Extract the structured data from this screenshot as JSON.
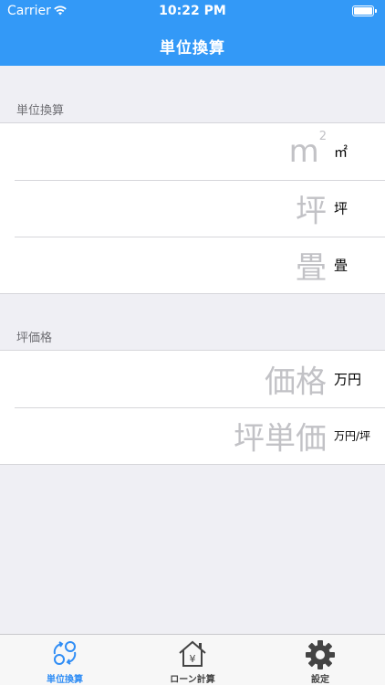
{
  "status_bar": {
    "carrier": "Carrier",
    "time": "10:22 PM"
  },
  "nav": {
    "title": "単位換算"
  },
  "area_section": {
    "title": "単位換算",
    "rows": [
      {
        "placeholder": "m",
        "placeholder_sup": "2",
        "unit": "㎡"
      },
      {
        "placeholder": "坪",
        "unit": "坪"
      },
      {
        "placeholder": "畳",
        "unit": "畳"
      }
    ]
  },
  "price_section": {
    "title": "坪価格",
    "rows": [
      {
        "placeholder": "価格",
        "unit": "万円"
      },
      {
        "placeholder": "坪単価",
        "unit": "万円/坪"
      }
    ]
  },
  "tabs": [
    {
      "label": "単位換算",
      "icon": "convert-icon",
      "active": true
    },
    {
      "label": "ローン計算",
      "icon": "house-yen-icon",
      "active": false
    },
    {
      "label": "設定",
      "icon": "gear-icon",
      "active": false
    }
  ],
  "colors": {
    "accent": "#3399f7",
    "tab_active": "#2f8df5",
    "placeholder": "#c2c2c6"
  }
}
